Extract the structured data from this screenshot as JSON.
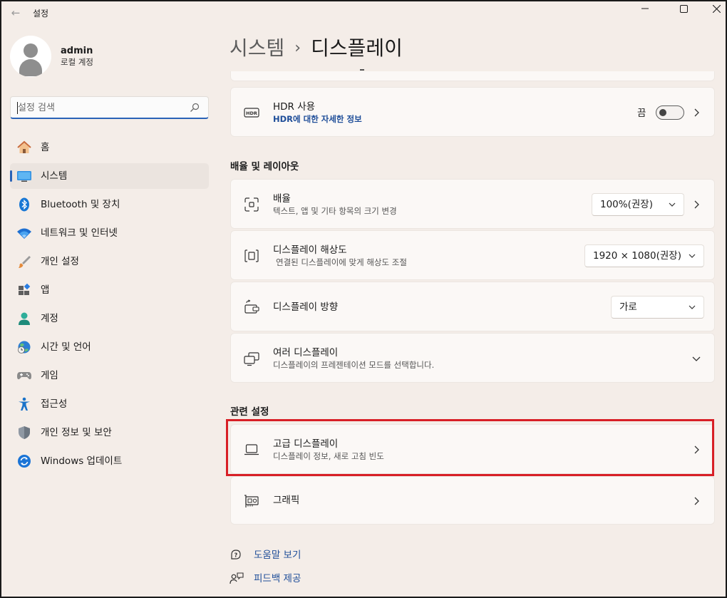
{
  "window": {
    "title": "설정"
  },
  "profile": {
    "name": "admin",
    "account_type": "로컬 계정"
  },
  "search": {
    "placeholder": "설정 검색"
  },
  "sidebar": {
    "items": [
      {
        "label": "홈",
        "icon": "home-icon"
      },
      {
        "label": "시스템",
        "icon": "system-icon",
        "active": true
      },
      {
        "label": "Bluetooth 및 장치",
        "icon": "bluetooth-icon"
      },
      {
        "label": "네트워크 및 인터넷",
        "icon": "wifi-icon"
      },
      {
        "label": "개인 설정",
        "icon": "brush-icon"
      },
      {
        "label": "앱",
        "icon": "apps-icon"
      },
      {
        "label": "계정",
        "icon": "account-icon"
      },
      {
        "label": "시간 및 언어",
        "icon": "time-language-icon"
      },
      {
        "label": "게임",
        "icon": "gamepad-icon"
      },
      {
        "label": "접근성",
        "icon": "accessibility-icon"
      },
      {
        "label": "개인 정보 및 보안",
        "icon": "shield-icon"
      },
      {
        "label": "Windows 업데이트",
        "icon": "update-icon"
      }
    ]
  },
  "breadcrumb": {
    "parent": "시스템",
    "separator": "›",
    "current": "디스플레이"
  },
  "hdr": {
    "title": "HDR 사용",
    "link": "HDR에 대한 자세한 정보",
    "toggle_state": "끔",
    "toggle_on": false
  },
  "scale_layout": {
    "heading": "배율 및 레이아웃",
    "scale": {
      "title": "배율",
      "subtitle": "텍스트, 앱 및 기타 항목의 크기 변경",
      "value": "100%(권장)"
    },
    "resolution": {
      "title": "디스플레이 해상도",
      "subtitle": "연결된 디스플레이에 맞게 해상도 조절",
      "value": "1920 × 1080(권장)"
    },
    "orientation": {
      "title": "디스플레이 방향",
      "value": "가로"
    },
    "multiple": {
      "title": "여러 디스플레이",
      "subtitle": "디스플레이의 프레젠테이션 모드를 선택합니다."
    }
  },
  "related": {
    "heading": "관련 설정",
    "advanced": {
      "title": "고급 디스플레이",
      "subtitle": "디스플레이 정보, 새로 고침 빈도"
    },
    "graphics": {
      "title": "그래픽"
    }
  },
  "footer": {
    "help": "도움말 보기",
    "feedback": "피드백 제공"
  },
  "colors": {
    "accent": "#2a63b7",
    "highlight": "#d81f26",
    "background": "#f4ede8"
  }
}
